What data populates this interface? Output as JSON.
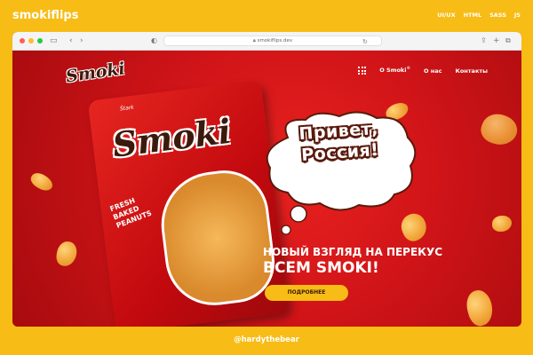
{
  "portfolio": {
    "brand": "smokiflips",
    "tags": [
      "UI/UX",
      "HTML",
      "SASS",
      "JS"
    ],
    "watermark": "@hardythebear"
  },
  "browser": {
    "url": "smokiflips.dev"
  },
  "site": {
    "logo": "Smoki",
    "nav": {
      "item1": "О Smoki",
      "item1_badge": "®",
      "item2": "О нас",
      "item3": "Контакты"
    },
    "hero": {
      "greeting_line1": "Привет,",
      "greeting_line2": "Россия!",
      "tagline_line1": "НОВЫЙ ВЗГЛЯД НА ПЕРЕКУС",
      "tagline_line2": "ВСЕМ SMOKI!",
      "cta": "ПОДРОБНЕЕ"
    },
    "product": {
      "brand": "Smoki",
      "seal": "Štark",
      "label": "FRESH BAKED PEANUTS"
    }
  },
  "colors": {
    "background": "#F7BC15",
    "hero_red": "#D01418",
    "accent_yellow": "#F7BC15",
    "brown": "#3B1A0C"
  }
}
